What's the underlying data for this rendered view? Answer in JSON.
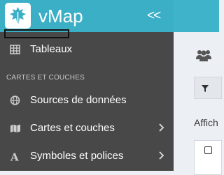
{
  "brand": {
    "name": "vMap",
    "collapse_symbol": "<<",
    "logo_icon": "leaf-logo"
  },
  "colors": {
    "topbar": "#3fb3c9",
    "sidebar": "#484848",
    "content": "#ecf0f5"
  },
  "sidebar": {
    "top_item": {
      "label": "Tableaux",
      "icon": "table-icon"
    },
    "section_title": "CARTES ET COUCHES",
    "items": [
      {
        "label": "Sources de données",
        "icon": "globe-icon",
        "has_submenu": false
      },
      {
        "label": "Cartes et couches",
        "icon": "map-icon",
        "has_submenu": true
      },
      {
        "label": "Symboles et polices",
        "icon": "font-icon",
        "has_submenu": true
      }
    ]
  },
  "main": {
    "header_icon": "users-icon",
    "filter_icon": "filter-icon",
    "show_label": "Affich"
  }
}
